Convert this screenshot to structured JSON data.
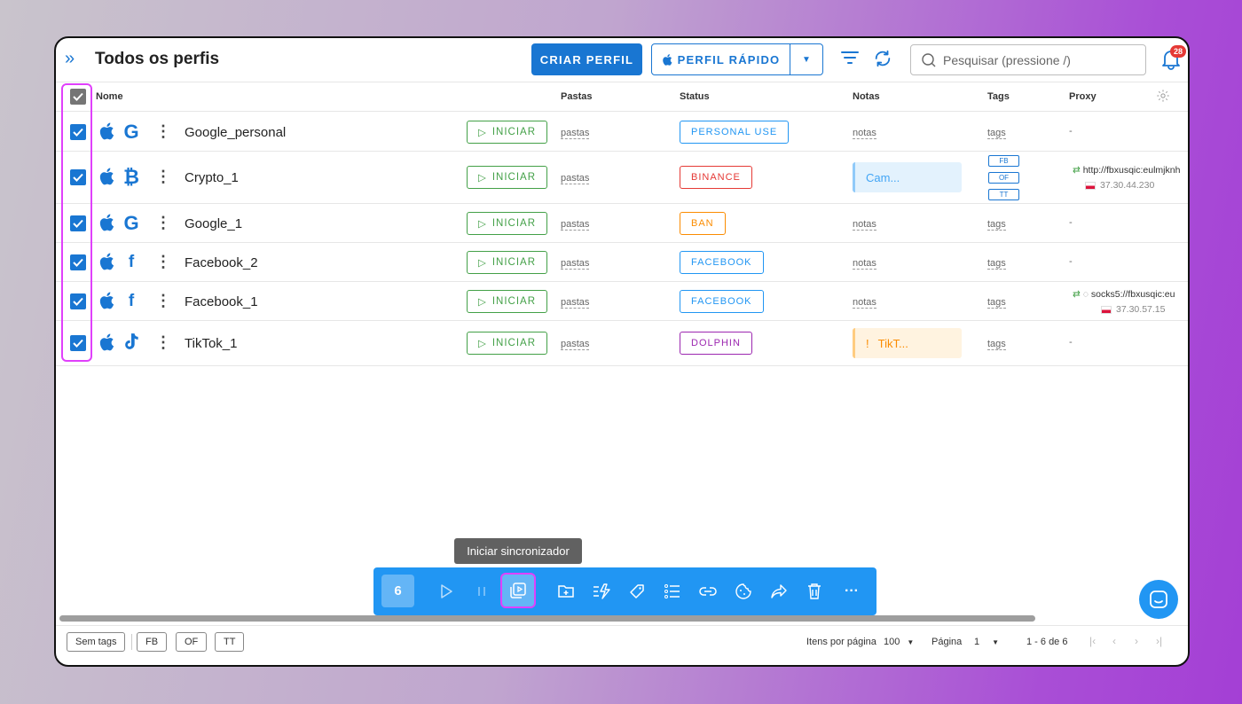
{
  "header": {
    "title": "Todos os perfis",
    "criar_label": "CRIAR PERFIL",
    "rapido_label": "PERFIL RÁPIDO",
    "search_placeholder": "Pesquisar (pressione /)",
    "notif_count": "28"
  },
  "columns": {
    "nome": "Nome",
    "pastas": "Pastas",
    "status": "Status",
    "notas": "Notas",
    "tags": "Tags",
    "proxy": "Proxy"
  },
  "rows": [
    {
      "name": "Google_personal",
      "brand": "google-icon",
      "start": "INICIAR",
      "pastas": "pastas",
      "status": "PERSONAL USE",
      "status_color": "#2196f3",
      "notas": "notas",
      "tags": "tags",
      "proxy": "-"
    },
    {
      "name": "Crypto_1",
      "brand": "bitcoin-icon",
      "start": "INICIAR",
      "pastas": "pastas",
      "status": "BINANCE",
      "status_color": "#e53935",
      "note": "Cam...",
      "tag_pills": [
        "FB",
        "OF",
        "TT"
      ],
      "proxy_url": "http://fbxusqic:eulmjknh",
      "proxy_ip": "37.30.44.230"
    },
    {
      "name": "Google_1",
      "brand": "google-icon",
      "start": "INICIAR",
      "pastas": "pastas",
      "status": "BAN",
      "status_color": "#fb8c00",
      "notas": "notas",
      "tags": "tags",
      "proxy": "-"
    },
    {
      "name": "Facebook_2",
      "brand": "facebook-icon",
      "start": "INICIAR",
      "pastas": "pastas",
      "status": "FACEBOOK",
      "status_color": "#2196f3",
      "notas": "notas",
      "tags": "tags",
      "proxy": "-"
    },
    {
      "name": "Facebook_1",
      "brand": "facebook-icon",
      "start": "INICIAR",
      "pastas": "pastas",
      "status": "FACEBOOK",
      "status_color": "#2196f3",
      "notas": "notas",
      "tags": "tags",
      "proxy_url": "socks5://fbxusqic:eu",
      "proxy_ip": "37.30.57.15"
    },
    {
      "name": "TikTok_1",
      "brand": "tiktok-icon",
      "start": "INICIAR",
      "pastas": "pastas",
      "status": "DOLPHIN",
      "status_color": "#9c27b0",
      "note": "TikT...",
      "tags": "tags",
      "proxy": "-"
    }
  ],
  "bulk": {
    "count": "6",
    "tooltip": "Iniciar sincronizador"
  },
  "footer": {
    "tags": [
      "Sem tags",
      "FB",
      "OF",
      "TT"
    ],
    "per_page_label": "Itens por página",
    "per_page": "100",
    "page_label": "Página",
    "page": "1",
    "range": "1 - 6 de 6"
  },
  "colors": {
    "accent": "#1976d2",
    "highlight": "#e040fb",
    "start_green": "#43a047"
  }
}
